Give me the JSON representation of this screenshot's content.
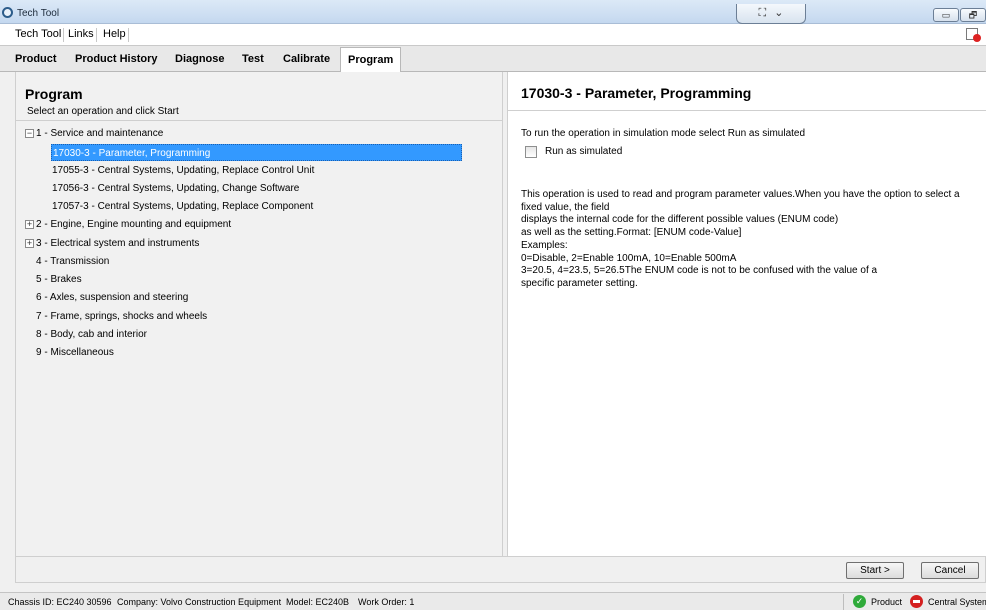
{
  "window": {
    "title": "Tech Tool",
    "controls": {
      "minimize": "▭",
      "restore": "🗗"
    },
    "center_icons": [
      "⛶",
      "⌄"
    ]
  },
  "menu": {
    "items": [
      "Tech Tool",
      "Links",
      "Help"
    ]
  },
  "tabs": [
    {
      "label": "Product",
      "active": false
    },
    {
      "label": "Product History",
      "active": false
    },
    {
      "label": "Diagnose",
      "active": false
    },
    {
      "label": "Test",
      "active": false
    },
    {
      "label": "Calibrate",
      "active": false
    },
    {
      "label": "Program",
      "active": true
    }
  ],
  "left": {
    "title": "Program",
    "subtitle": "Select an operation and click Start",
    "tree": [
      {
        "label": "1 - Service and maintenance",
        "toggle": "−",
        "level": 0
      },
      {
        "label": "17030-3 - Parameter, Programming",
        "level": 1,
        "selected": true
      },
      {
        "label": "17055-3 - Central Systems, Updating, Replace Control Unit",
        "level": 1
      },
      {
        "label": "17056-3 - Central Systems, Updating, Change Software",
        "level": 1
      },
      {
        "label": "17057-3 - Central Systems, Updating, Replace Component",
        "level": 1
      },
      {
        "label": "2 - Engine, Engine mounting and equipment",
        "toggle": "+",
        "level": 0
      },
      {
        "label": "3 - Electrical system and instruments",
        "toggle": "+",
        "level": 0
      },
      {
        "label": "4 - Transmission",
        "level": 0
      },
      {
        "label": "5 - Brakes",
        "level": 0
      },
      {
        "label": "6 - Axles, suspension and steering",
        "level": 0
      },
      {
        "label": "7 - Frame, springs, shocks and wheels",
        "level": 0
      },
      {
        "label": "8 - Body, cab and interior",
        "level": 0
      },
      {
        "label": "9 - Miscellaneous",
        "level": 0
      }
    ]
  },
  "right": {
    "title": "17030-3 - Parameter, Programming",
    "simulation_text": "To run the operation in simulation mode select Run as simulated",
    "checkbox_label": "Run as simulated",
    "checkbox_checked": false,
    "description_lines": [
      "This operation is used to read and program parameter values.When you have the option to select a fixed value, the field",
      "displays the internal code for the different possible values (ENUM code)",
      "as well as the setting.Format: [ENUM code-Value]",
      "Examples:",
      "0=Disable, 2=Enable 100mA, 10=Enable 500mA",
      "3=20.5, 4=23.5, 5=26.5The ENUM code is not to be confused with the value of a",
      "specific parameter setting."
    ]
  },
  "buttons": {
    "start": "Start >",
    "cancel": "Cancel"
  },
  "status": {
    "chassis": "Chassis ID: EC240 30596",
    "company": "Company: Volvo Construction Equipment",
    "model": "Model: EC240B",
    "work_order": "Work Order: 1",
    "product": "Product",
    "central_system": "Central System"
  }
}
